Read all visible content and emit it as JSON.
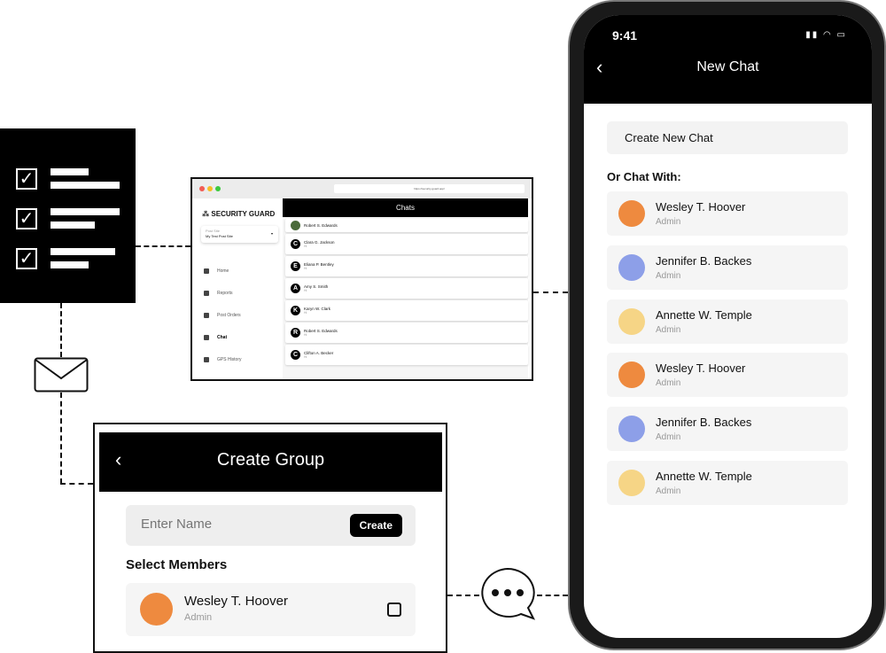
{
  "colors": {
    "avatar_orange": "#ee8a3f",
    "avatar_purple": "#8d9fe8",
    "avatar_yellow": "#f6d586",
    "black": "#000000"
  },
  "browser": {
    "url": "https://security-guard.app/",
    "brand": "SECURITY GUARD",
    "post_site_label": "Post Site",
    "post_site_value": "My Test Post Site",
    "nav": [
      {
        "label": "Home",
        "icon": "home-icon"
      },
      {
        "label": "Reports",
        "icon": "list-icon"
      },
      {
        "label": "Post Orders",
        "icon": "clipboard-icon"
      },
      {
        "label": "Chat",
        "icon": "chat-icon",
        "active": true
      },
      {
        "label": "GPS History",
        "icon": "location-icon"
      }
    ],
    "header": "Chats",
    "chats": [
      {
        "initial": "",
        "name": "Robert S. Edwards",
        "msg": ""
      },
      {
        "initial": "C",
        "name": "Clara G. Jackson",
        "msg": "Hi"
      },
      {
        "initial": "E",
        "name": "Eliana P. Bentley",
        "msg": "Hi"
      },
      {
        "initial": "A",
        "name": "Amy S. Smith",
        "msg": "Hi"
      },
      {
        "initial": "K",
        "name": "Karyn W. Clark",
        "msg": "Hi"
      },
      {
        "initial": "R",
        "name": "Robert S. Edwards",
        "msg": "Hi"
      },
      {
        "initial": "C",
        "name": "Clifton A. Becker",
        "msg": "Hi"
      }
    ]
  },
  "group": {
    "title": "Create Group",
    "name_placeholder": "Enter Name",
    "create_label": "Create",
    "select_members": "Select Members",
    "member": {
      "name": "Wesley T. Hoover",
      "role": "Admin",
      "checked": false
    }
  },
  "phone": {
    "time": "9:41",
    "title": "New Chat",
    "create_new": "Create New Chat",
    "or_chat_with": "Or Chat With:",
    "contacts": [
      {
        "name": "Wesley T. Hoover",
        "role": "Admin",
        "color": "#ee8a3f"
      },
      {
        "name": "Jennifer B. Backes",
        "role": "Admin",
        "color": "#8d9fe8"
      },
      {
        "name": "Annette W. Temple",
        "role": "Admin",
        "color": "#f6d586"
      },
      {
        "name": "Wesley T. Hoover",
        "role": "Admin",
        "color": "#ee8a3f"
      },
      {
        "name": "Jennifer B. Backes",
        "role": "Admin",
        "color": "#8d9fe8"
      },
      {
        "name": "Annette W. Temple",
        "role": "Admin",
        "color": "#f6d586"
      }
    ]
  }
}
